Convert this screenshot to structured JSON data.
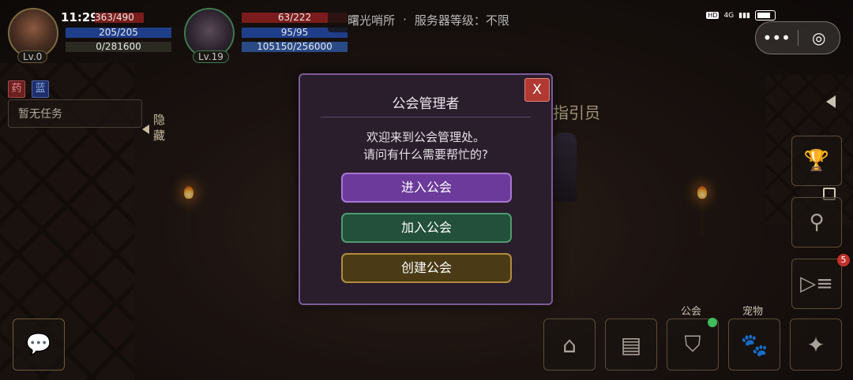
{
  "status_bar": {
    "time": "11:29",
    "network": "4G",
    "hd": "HD"
  },
  "player": {
    "level": "Lv.0",
    "hp": "363/490",
    "mp": "205/205",
    "exp": "0/281600"
  },
  "pet": {
    "level": "Lv.19",
    "hp": "63/222",
    "mp": "95/95",
    "exp": "105150/256000"
  },
  "server": {
    "location": "曙光哨所",
    "separator": "·",
    "level_text": "服务器等级：不限"
  },
  "capsule": {
    "more_icon": "•••",
    "target_icon": "◎"
  },
  "left_panel": {
    "tag1": "药",
    "tag2": "蓝",
    "quest_text": "暂无任务",
    "hide_label": "隐藏"
  },
  "npc": {
    "label": "指引员"
  },
  "dialog": {
    "title": "公会管理者",
    "message_line1": "欢迎来到公会管理处。",
    "message_line2": "请问有什么需要帮忙的?",
    "close": "X",
    "btn_enter": "进入公会",
    "btn_join": "加入公会",
    "btn_create": "创建公会"
  },
  "right_menu": {
    "badge_count": "5"
  },
  "bottom_labels": {
    "guild": "公会",
    "pet": "宠物"
  },
  "colors": {
    "dialog_border": "#7b5b9a",
    "enter_btn": "#6b3a9a",
    "join_btn": "#22503a",
    "create_btn": "#4a3a16",
    "close_btn": "#b03a33"
  }
}
